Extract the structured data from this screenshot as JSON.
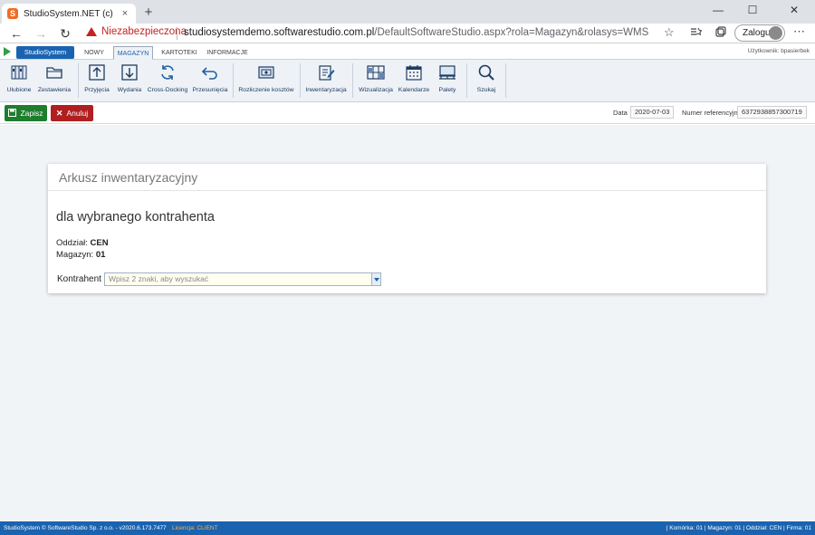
{
  "browser": {
    "tab_title": "StudioSystem.NET (c) SoftwareSt",
    "tab_close": "×",
    "new_tab": "+",
    "security_warning": "Niezabezpieczona",
    "url_host": "studiosystemdemo.softwarestudio.com.pl",
    "url_path": "/DefaultSoftwareStudio.aspx?rola=Magazyn&rolasys=WMS",
    "login_label": "Zaloguj",
    "back": "←",
    "forward": "→",
    "reload": "↻",
    "star": "☆",
    "more": "⋯",
    "win_min": "—",
    "win_max": "☐",
    "win_close": "✕"
  },
  "app_menu": {
    "brand": "StudioSystem",
    "tabs": [
      {
        "label": "NOWY"
      },
      {
        "label": "MAGAZYN"
      },
      {
        "label": "KARTOTEKI"
      },
      {
        "label": "INFORMACJE"
      }
    ],
    "user": "Użytkownik: bpasierbek"
  },
  "ribbon": {
    "items": [
      {
        "label": "Ulubione",
        "icon": "books-icon"
      },
      {
        "label": "Zestawienia",
        "icon": "folder-icon"
      },
      {
        "label": "Przyjęcia",
        "icon": "arrow-up-box-icon"
      },
      {
        "label": "Wydania",
        "icon": "arrow-down-box-icon"
      },
      {
        "label": "Cross-Docking",
        "icon": "refresh-icon"
      },
      {
        "label": "Przesunięcia",
        "icon": "return-arrow-icon"
      },
      {
        "label": "Rozliczenie kosztów",
        "icon": "money-icon"
      },
      {
        "label": "Inwentaryzacja",
        "icon": "edit-document-icon"
      },
      {
        "label": "Wizualizacja",
        "icon": "shelves-icon"
      },
      {
        "label": "Kalendarze",
        "icon": "calendar-icon"
      },
      {
        "label": "Palety",
        "icon": "pallet-icon"
      },
      {
        "label": "Szukaj",
        "icon": "search-icon"
      }
    ]
  },
  "actions": {
    "save_label": "Zapisz",
    "cancel_label": "Anuluj",
    "date_label": "Data",
    "date_value": "2020-07-03",
    "ref_label": "Numer referencyjny",
    "ref_value": "6372938857300719"
  },
  "card": {
    "title": "Arkusz inwentaryzacyjny",
    "subtitle": "dla wybranego kontrahenta",
    "branch_label": "Oddział:",
    "branch_value": "CEN",
    "warehouse_label": "Magazyn:",
    "warehouse_value": "01",
    "contractor_label": "Kontrahent",
    "contractor_placeholder": "Wpisz 2 znaki, aby wyszukać"
  },
  "status_bar": {
    "left": "StudioSystem © SoftwareStudio Sp. z o.o. - v2020.6.173.7477",
    "license": "Licencja: CLIENT",
    "right": "| Komórka: 01 | Magazyn: 01 | Oddział: CEN | Firma: 01"
  },
  "colors": {
    "brand_blue": "#1a63b0",
    "save_green": "#1e7e2e",
    "cancel_red": "#b01f1f",
    "warning_red": "#c5221f"
  }
}
